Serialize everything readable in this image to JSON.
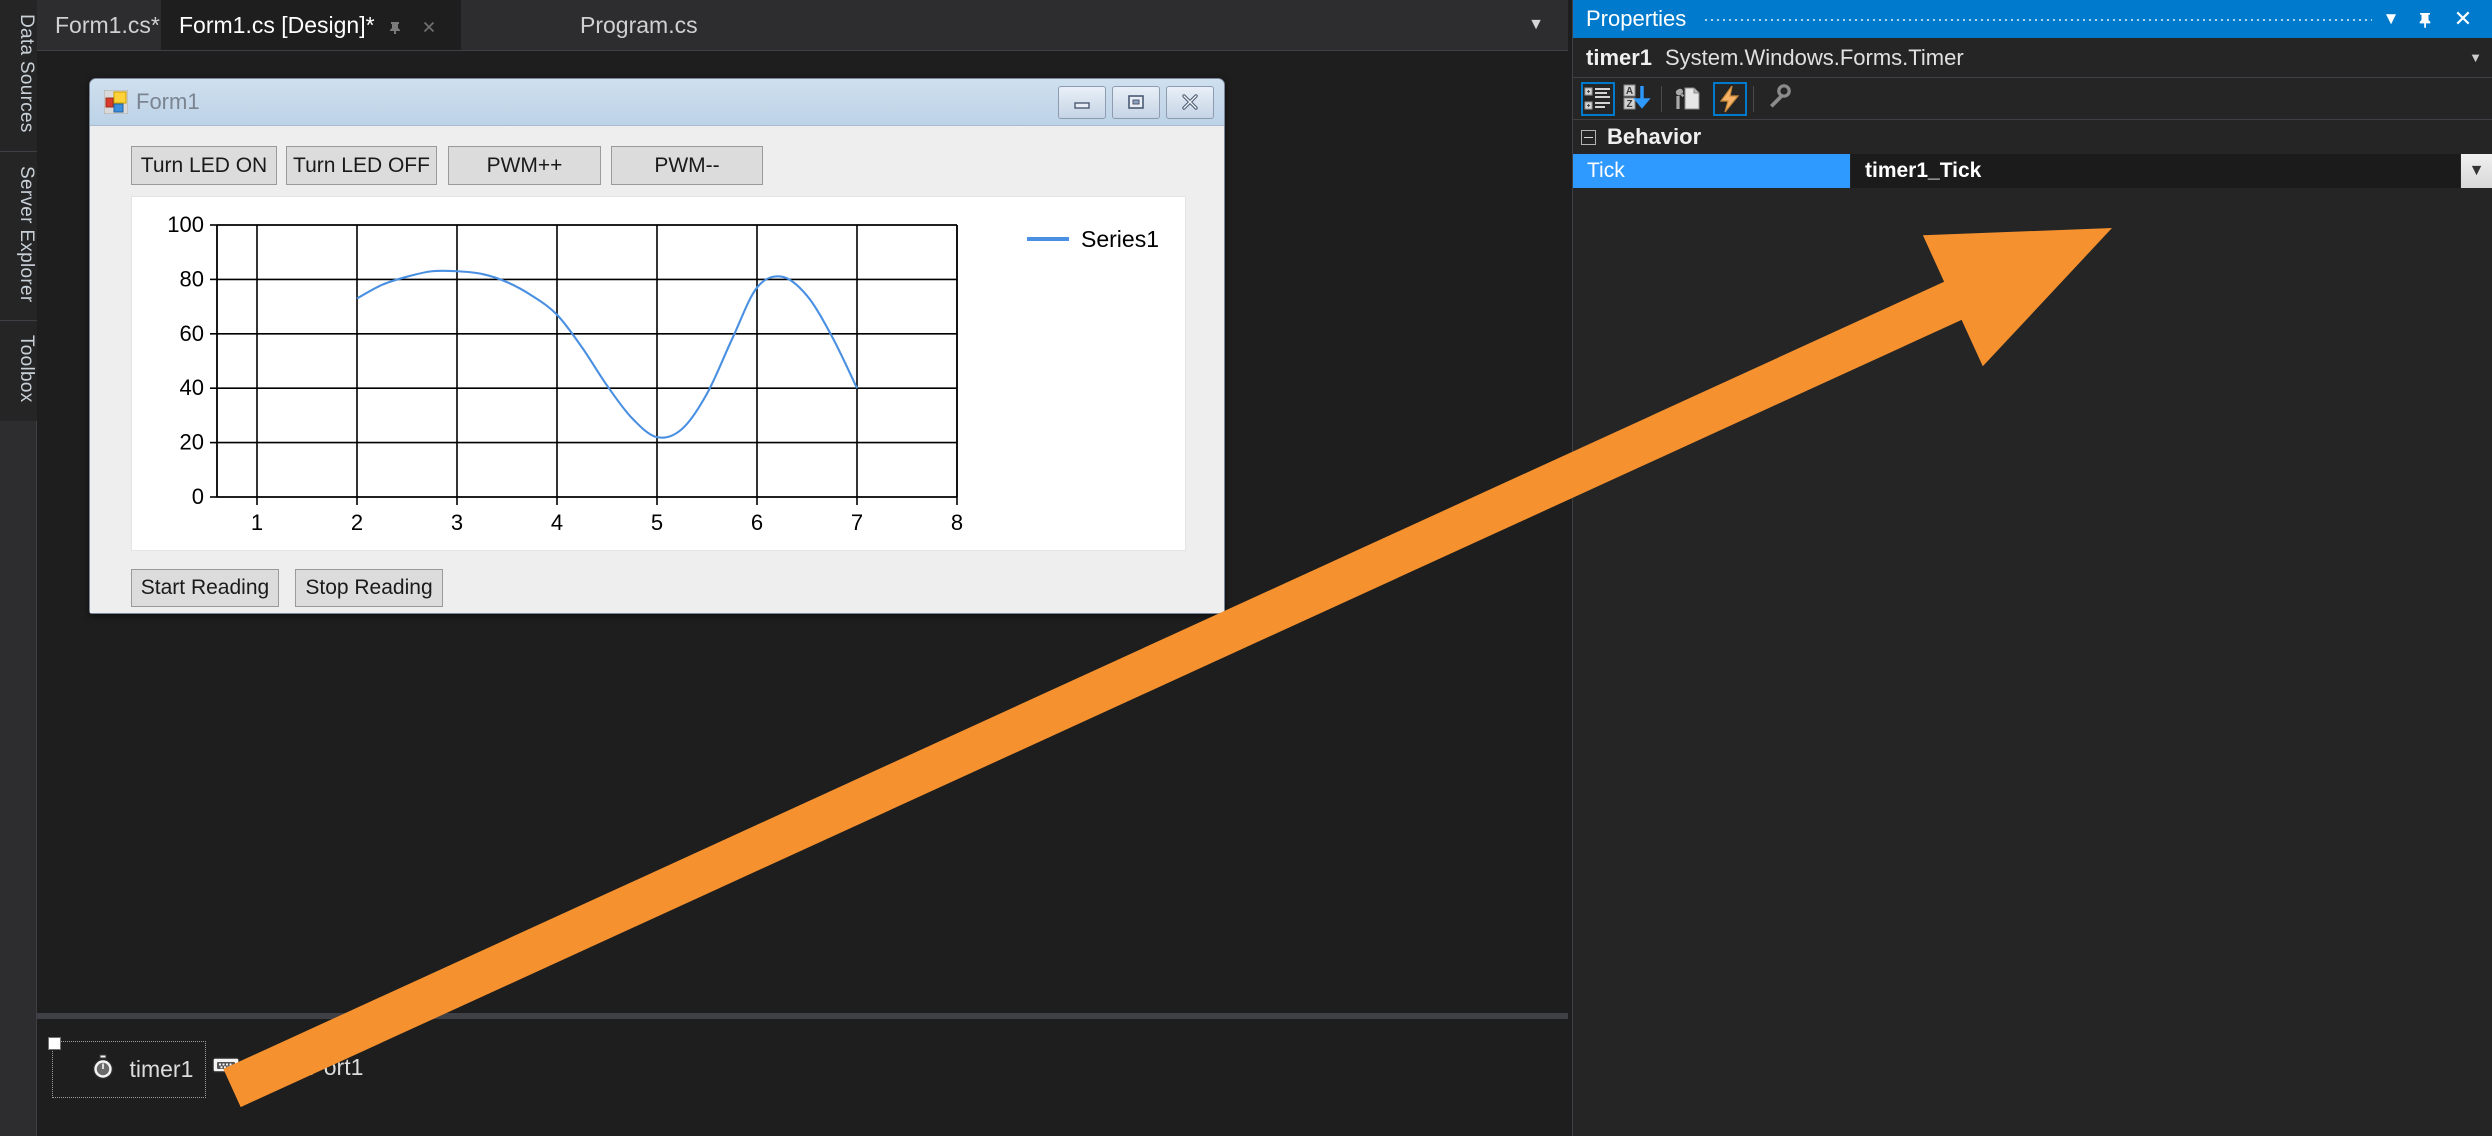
{
  "left_strip": {
    "tabs": [
      {
        "label": "Data Sources"
      },
      {
        "label": "Server Explorer"
      },
      {
        "label": "Toolbox"
      }
    ]
  },
  "tabbar": {
    "tabs": [
      {
        "label": "Form1.cs*",
        "active": false
      },
      {
        "label": "Form1.cs [Design]*",
        "active": true
      },
      {
        "label": "Program.cs",
        "active": false
      }
    ],
    "pin_icon": "pin-icon",
    "close_icon": "close-icon",
    "overflow_icon": "chevron-down-icon"
  },
  "form": {
    "title": "Form1",
    "icon": "windows-form-icon",
    "minimize_icon": "minimize-icon",
    "maximize_icon": "maximize-icon",
    "close_icon": "close-icon",
    "top_buttons": [
      {
        "label": "Turn LED ON"
      },
      {
        "label": "Turn LED OFF"
      },
      {
        "label": "PWM++"
      },
      {
        "label": "PWM--"
      }
    ],
    "bottom_buttons": [
      {
        "label": "Start Reading"
      },
      {
        "label": "Stop Reading"
      }
    ]
  },
  "chart_data": {
    "type": "line",
    "title": "",
    "xlabel": "",
    "ylabel": "",
    "legend": [
      "Series1"
    ],
    "legend_position": "top-right",
    "series_color": "#4a90e2",
    "grid": true,
    "xlim": [
      0.6,
      8.0
    ],
    "ylim": [
      0,
      100
    ],
    "xticks": [
      1,
      2,
      3,
      4,
      5,
      6,
      7,
      8
    ],
    "yticks": [
      0,
      20,
      40,
      60,
      80,
      100
    ],
    "series": [
      {
        "name": "Series1",
        "x": [
          2.0,
          2.25,
          2.5,
          2.75,
          3.0,
          3.25,
          3.5,
          3.75,
          4.0,
          4.25,
          4.5,
          4.75,
          5.0,
          5.25,
          5.5,
          5.75,
          6.0,
          6.25,
          6.5,
          6.75,
          7.0
        ],
        "y": [
          73,
          78,
          81,
          83,
          83,
          82,
          79,
          74,
          67,
          55,
          41,
          29,
          22,
          25,
          38,
          58,
          77,
          81,
          74,
          59,
          40
        ]
      }
    ]
  },
  "tray": {
    "items": [
      {
        "label": "timer1",
        "icon": "timer-icon",
        "selected": true
      },
      {
        "label": "serialPort1",
        "icon": "serial-port-icon",
        "selected": false
      }
    ]
  },
  "properties": {
    "panel_title": "Properties",
    "menu_icon": "chevron-down-icon",
    "pin_icon": "pin-icon",
    "close_icon": "close-icon",
    "object_name": "timer1",
    "object_type": "System.Windows.Forms.Timer",
    "object_chevron_icon": "chevron-down-icon",
    "toolbar": [
      {
        "name": "categorized-icon",
        "selected": true
      },
      {
        "name": "alphabetical-sort-icon",
        "selected": false
      },
      {
        "name": "properties-icon",
        "selected": false
      },
      {
        "name": "events-icon",
        "selected": true
      },
      {
        "name": "property-pages-icon",
        "selected": false
      }
    ],
    "category": "Behavior",
    "rows": [
      {
        "name": "Tick",
        "value": "timer1_Tick",
        "selected": true
      }
    ],
    "value_dropdown_icon": "chevron-down-icon"
  },
  "annotation": {
    "arrow_color": "#f5912e",
    "arrow_name": "orange-pointer-arrow"
  }
}
